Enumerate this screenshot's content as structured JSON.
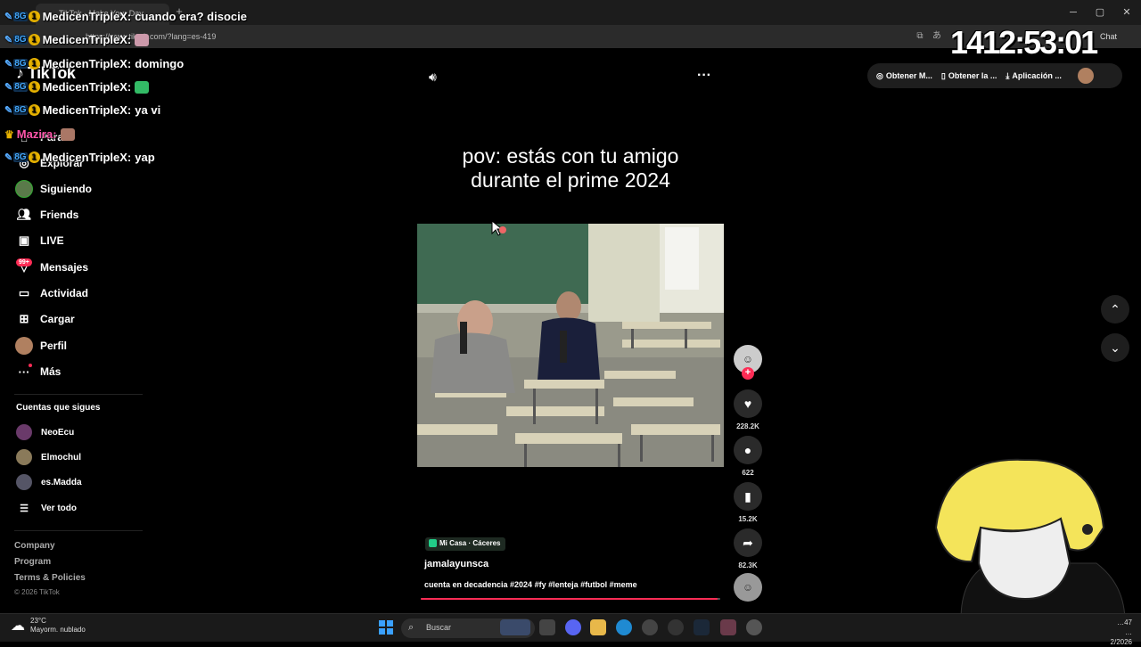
{
  "browser": {
    "tab_title": "TikTok - Make Your Day",
    "url": "https://www.tiktok.com/?lang=es-419",
    "chat_label": "Chat"
  },
  "sidebar": {
    "logo": "TikTok",
    "items": [
      {
        "label": "Para ti",
        "icon": "home-icon"
      },
      {
        "label": "Explorar",
        "icon": "compass-icon"
      },
      {
        "label": "Siguiendo",
        "icon": "avatar"
      },
      {
        "label": "Friends",
        "icon": "friends-icon"
      },
      {
        "label": "LIVE",
        "icon": "live-icon"
      },
      {
        "label": "Mensajes",
        "icon": "messages-icon",
        "badge": "99+"
      },
      {
        "label": "Actividad",
        "icon": "activity-icon"
      },
      {
        "label": "Cargar",
        "icon": "upload-icon"
      },
      {
        "label": "Perfil",
        "icon": "avatar"
      },
      {
        "label": "Más",
        "icon": "more-icon"
      }
    ],
    "following_title": "Cuentas que sigues",
    "following": [
      "NeoEcu",
      "Elmochul",
      "es.Madda"
    ],
    "see_all": "Ver todo",
    "footer": [
      "Company",
      "Program",
      "Terms & Policies"
    ],
    "copyright": "© 2026 TikTok"
  },
  "header_buttons": [
    "Obtener M...",
    "Obtener la ...",
    "Aplicación ..."
  ],
  "video": {
    "caption_line1": "pov: estás con tu amigo",
    "caption_line2": "durante el prime 2024",
    "location": "Mi Casa · Cáceres",
    "author": "jamalayunsca",
    "description": "cuenta en decadencia #2024 #fy #lenteja #futbol #meme",
    "progress": 0.99,
    "likes": "228.2K",
    "comments": "622",
    "saves": "15.2K",
    "shares": "82.3K"
  },
  "stream_overlay": {
    "timer": "1412:53:01",
    "chat": [
      {
        "user": "MedicenTripleX:",
        "message": "cuando era? disocie"
      },
      {
        "user": "MedicenTripleX:",
        "message": "",
        "emote_color": "#c9a"
      },
      {
        "user": "MedicenTripleX:",
        "message": "domingo"
      },
      {
        "user": "MedicenTripleX:",
        "message": "",
        "emote_color": "#3b6"
      },
      {
        "user": "MedicenTripleX:",
        "message": "ya vi"
      },
      {
        "user": "Mazira:",
        "message": "",
        "emote_color": "#a76",
        "crown": true
      },
      {
        "user": "MedicenTripleX:",
        "message": "yap"
      }
    ]
  },
  "taskbar": {
    "temperature": "23°C",
    "weather": "Mayorm. nublado",
    "search_placeholder": "Buscar",
    "time": "…47",
    "date": "…2/2026"
  },
  "colors": {
    "accent": "#fe2c55",
    "background": "#000000"
  }
}
